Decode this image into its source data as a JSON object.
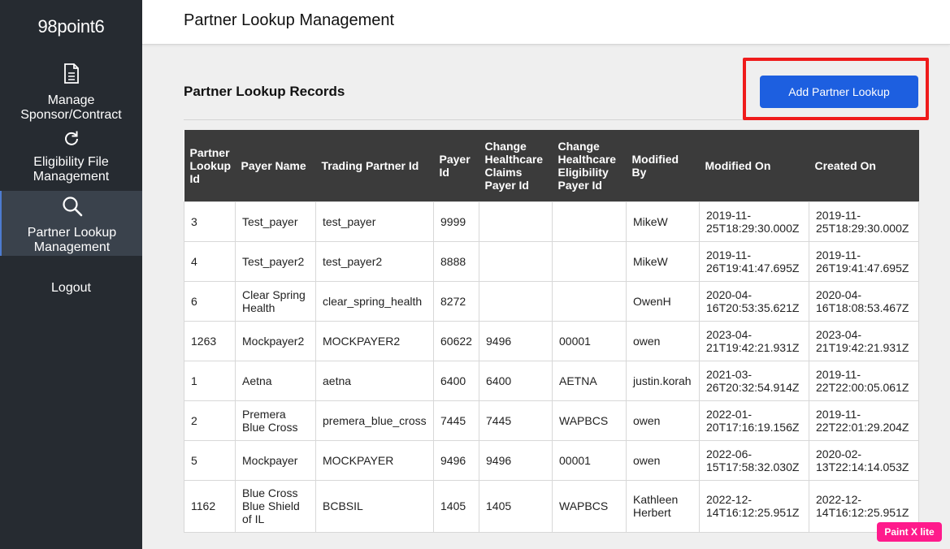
{
  "sidebar": {
    "logo": "98point6",
    "items": [
      {
        "label_line1": "Manage",
        "label_line2": "Sponsor/Contract",
        "icon": "document-icon"
      },
      {
        "label_line1": "Eligibility File",
        "label_line2": "Management",
        "icon": "refresh-icon"
      },
      {
        "label_line1": "Partner Lookup",
        "label_line2": "Management",
        "icon": "search-icon",
        "active": true
      }
    ],
    "logout": "Logout"
  },
  "header": {
    "title": "Partner Lookup Management"
  },
  "main": {
    "section_title": "Partner Lookup Records",
    "add_button": "Add Partner Lookup"
  },
  "table": {
    "columns": [
      "Partner Lookup Id",
      "Payer Name",
      "Trading Partner Id",
      "Payer Id",
      "Change Healthcare Claims Payer Id",
      "Change Healthcare Eligibility Payer Id",
      "Modified By",
      "Modified On",
      "Created On"
    ],
    "rows": [
      [
        "3",
        "Test_payer",
        "test_payer",
        "9999",
        "",
        "",
        "MikeW",
        "2019-11-25T18:29:30.000Z",
        "2019-11-25T18:29:30.000Z"
      ],
      [
        "4",
        "Test_payer2",
        "test_payer2",
        "8888",
        "",
        "",
        "MikeW",
        "2019-11-26T19:41:47.695Z",
        "2019-11-26T19:41:47.695Z"
      ],
      [
        "6",
        "Clear Spring Health",
        "clear_spring_health",
        "8272",
        "",
        "",
        "OwenH",
        "2020-04-16T20:53:35.621Z",
        "2020-04-16T18:08:53.467Z"
      ],
      [
        "1263",
        "Mockpayer2",
        "MOCKPAYER2",
        "60622",
        "9496",
        "00001",
        "owen",
        "2023-04-21T19:42:21.931Z",
        "2023-04-21T19:42:21.931Z"
      ],
      [
        "1",
        "Aetna",
        "aetna",
        "6400",
        "6400",
        "AETNA",
        "justin.korah",
        "2021-03-26T20:32:54.914Z",
        "2019-11-22T22:00:05.061Z"
      ],
      [
        "2",
        "Premera Blue Cross",
        "premera_blue_cross",
        "7445",
        "7445",
        "WAPBCS",
        "owen",
        "2022-01-20T17:16:19.156Z",
        "2019-11-22T22:01:29.204Z"
      ],
      [
        "5",
        "Mockpayer",
        "MOCKPAYER",
        "9496",
        "9496",
        "00001",
        "owen",
        "2022-06-15T17:58:32.030Z",
        "2020-02-13T22:14:14.053Z"
      ],
      [
        "1162",
        "Blue Cross Blue Shield of IL",
        "BCBSIL",
        "1405",
        "1405",
        "WAPBCS",
        "Kathleen Herbert",
        "2022-12-14T16:12:25.951Z",
        "2022-12-14T16:12:25.951Z"
      ]
    ]
  },
  "overlay": {
    "badge": "Paint X lite"
  },
  "colors": {
    "sidebar": "#262b31",
    "accent_button": "#1d5fe0",
    "highlight": "#ef1b1b",
    "table_header": "#3b3b3b"
  }
}
